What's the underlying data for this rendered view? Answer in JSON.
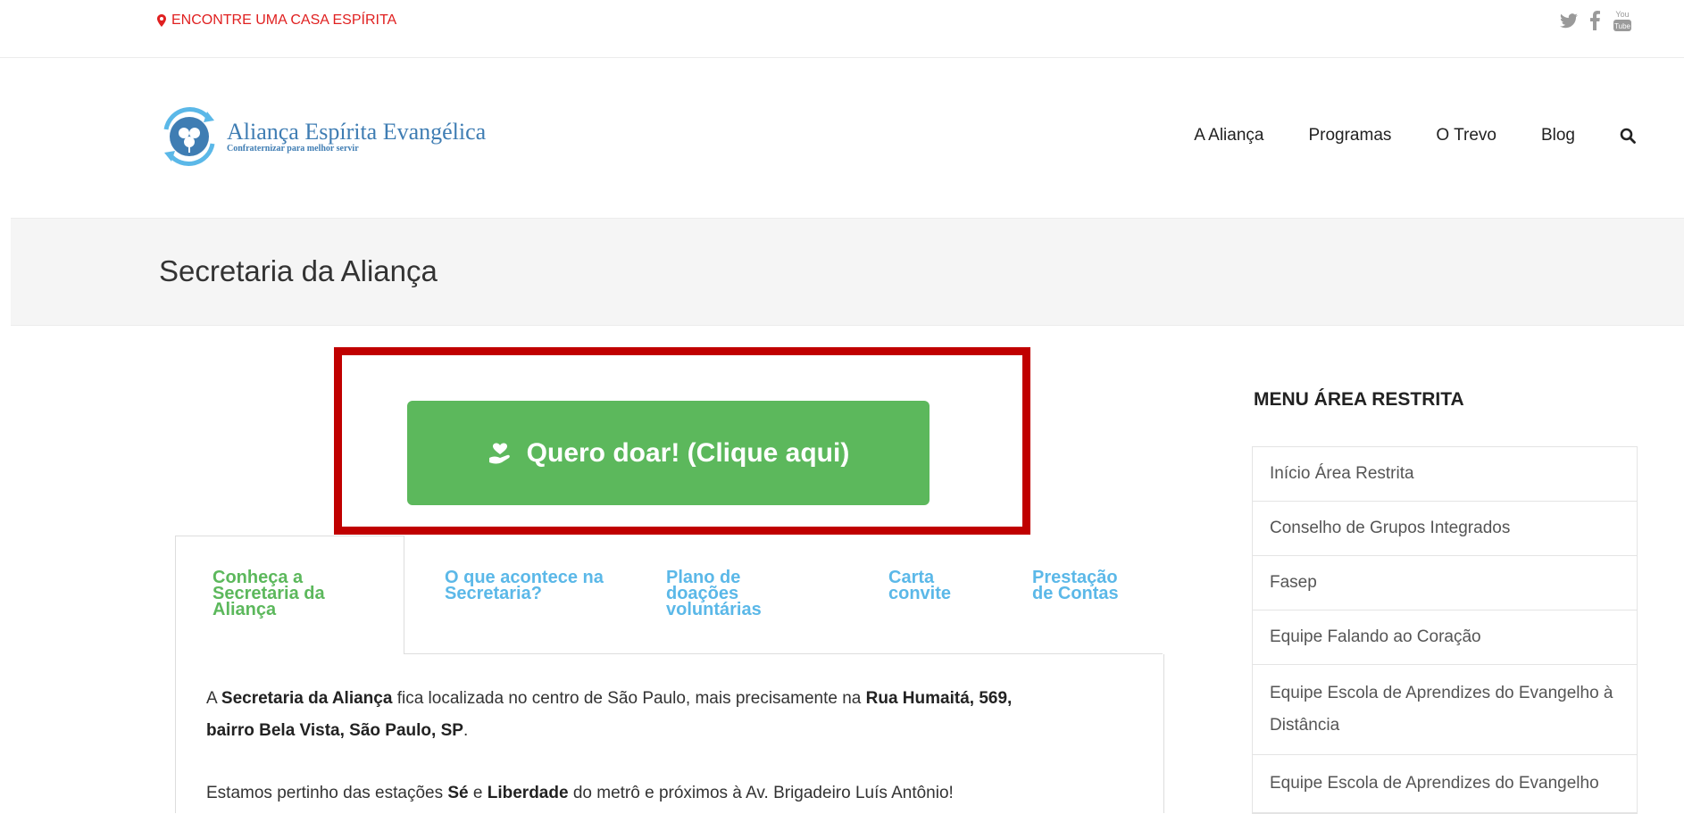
{
  "topbar": {
    "locate_text": "ENCONTRE UMA CASA ESPÍRITA",
    "social": [
      "twitter-icon",
      "facebook-icon",
      "youtube-icon"
    ],
    "youtube_text_top": "You",
    "youtube_text_bottom": "Tube"
  },
  "header": {
    "brand_title": "Aliança Espírita Evangélica",
    "brand_subtitle": "Confraternizar para melhor servir",
    "nav": [
      "A Aliança",
      "Programas",
      "O Trevo",
      "Blog"
    ]
  },
  "page": {
    "title": "Secretaria da Aliança"
  },
  "donate": {
    "label": "Quero doar! (Clique aqui)"
  },
  "tabs": [
    {
      "label": "Conheça a Secretaria da Aliança",
      "active": true
    },
    {
      "label": "O que acontece na Secretaria?",
      "active": false
    },
    {
      "label": "Plano de doações voluntárias",
      "active": false
    },
    {
      "label": "Carta convite",
      "active": false
    },
    {
      "label": "Prestação de Contas",
      "active": false
    }
  ],
  "content": {
    "p1_a": "A ",
    "p1_b": "Secretaria da Aliança",
    "p1_c": " fica localizada no centro de São Paulo, mais precisamente na ",
    "p1_d": "Rua Humaitá, 569,",
    "p1_e": "bairro Bela Vista, São Paulo, SP",
    "p1_f": ".",
    "p2_a": "Estamos pertinho das estações ",
    "p2_b": "Sé",
    "p2_c": " e ",
    "p2_d": "Liberdade",
    "p2_e": " do metrô e próximos à Av. Brigadeiro Luís Antônio!"
  },
  "sidebar": {
    "title": "MENU ÁREA RESTRITA",
    "items": [
      "Início Área Restrita",
      "Conselho de Grupos Integrados",
      "Fasep",
      "Equipe Falando ao Coração",
      "Equipe Escola de Aprendizes do Evangelho à Distância",
      "Equipe Escola de Aprendizes do Evangelho"
    ]
  },
  "colors": {
    "accent_red": "#e02020",
    "brand_blue": "#3f7db3",
    "donate_green": "#5cb85c",
    "tab_blue": "#5bb8e8",
    "highlight_box": "#c00000"
  }
}
